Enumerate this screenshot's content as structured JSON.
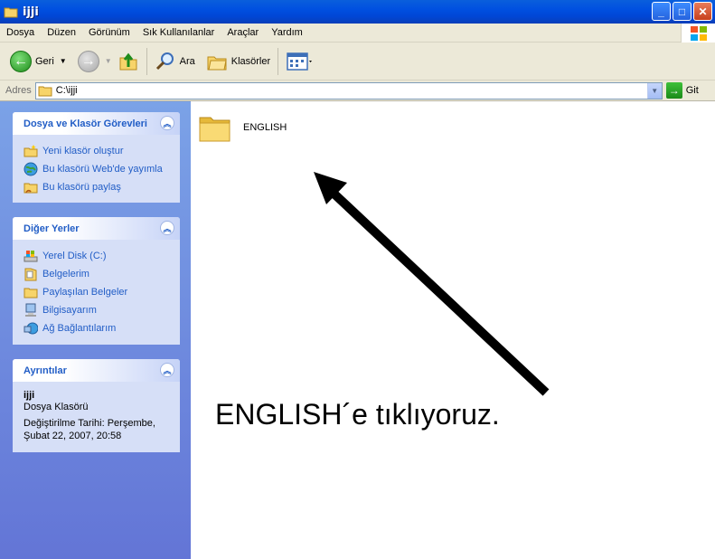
{
  "window": {
    "title": "ijji",
    "minimize_icon": "minimize-icon",
    "maximize_icon": "maximize-icon",
    "close_icon": "close-icon"
  },
  "menu": [
    "Dosya",
    "Düzen",
    "Görünüm",
    "Sık Kullanılanlar",
    "Araçlar",
    "Yardım"
  ],
  "toolbar": {
    "back_label": "Geri",
    "search_label": "Ara",
    "folders_label": "Klasörler"
  },
  "address": {
    "label": "Adres",
    "value": "C:\\ijji",
    "go_label": "Git"
  },
  "tasks_panel": {
    "title": "Dosya ve Klasör Görevleri",
    "items": [
      {
        "label": "Yeni klasör oluştur",
        "icon": "new-folder-icon"
      },
      {
        "label": "Bu klasörü Web'de yayımla",
        "icon": "web-publish-icon"
      },
      {
        "label": "Bu klasörü paylaş",
        "icon": "share-folder-icon"
      }
    ]
  },
  "places_panel": {
    "title": "Diğer Yerler",
    "items": [
      {
        "label": "Yerel Disk (C:)",
        "icon": "local-disk-icon"
      },
      {
        "label": "Belgelerim",
        "icon": "my-documents-icon"
      },
      {
        "label": "Paylaşılan Belgeler",
        "icon": "shared-documents-icon"
      },
      {
        "label": "Bilgisayarım",
        "icon": "my-computer-icon"
      },
      {
        "label": "Ağ Bağlantılarım",
        "icon": "network-icon"
      }
    ]
  },
  "details_panel": {
    "title": "Ayrıntılar",
    "name": "ijji",
    "type": "Dosya Klasörü",
    "modified_line1": "Değiştirilme Tarihi: Perşembe,",
    "modified_line2": "Şubat 22, 2007, 20:58"
  },
  "content": {
    "folder_label": "ENGLISH",
    "annotation": "ENGLISH´e tıklıyoruz."
  },
  "colors": {
    "title_bar": "#0050e0",
    "task_link": "#215dc6",
    "left_pane": "#7ba2e7"
  }
}
